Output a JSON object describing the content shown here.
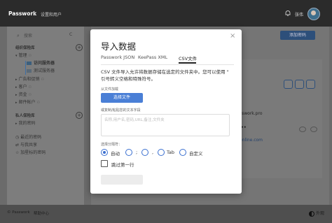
{
  "app": {
    "logo": "Passwork",
    "breadcrumb": "设置和用户",
    "user_name": "张伟"
  },
  "sidebar": {
    "search_placeholder": "搜索",
    "search_shortcut": "C",
    "org_section": "组织保险库",
    "items": [
      {
        "label": "管理"
      },
      {
        "label": "访问服务器"
      },
      {
        "label": "测试服务器"
      },
      {
        "label": "广告和促销"
      },
      {
        "label": "客户"
      },
      {
        "label": "资金"
      },
      {
        "label": "邮件帐户"
      }
    ],
    "private_section": "私人保险库",
    "private_items": [
      {
        "label": "我的密码"
      }
    ],
    "bottom_items": [
      {
        "label": "最近的密码"
      },
      {
        "label": "与我共享"
      },
      {
        "label": "加星标的密码"
      }
    ]
  },
  "content": {
    "add_password": "添加密码",
    "card_lines": [
      "sswork.pro",
      "••",
      "online.com"
    ]
  },
  "footer": {
    "copyright": "© Passwork",
    "help": "帮助中心",
    "theme": "外观"
  },
  "modal": {
    "title": "导入数据",
    "tabs": [
      "Passwork JSON",
      "KeePass XML",
      "CSV文件"
    ],
    "description": "CSV 文件导入允许将数据存储在选定的文件夹中。您可以使用 \" 引号转义空格和特殊符号。",
    "from_file_label": "从文件加载",
    "choose_file": "选择文件",
    "or_paste_label": "或复制/粘贴您的文本字段",
    "textarea_placeholder": "名称,用户名,密码,URL,备注,文件夹",
    "separator_label": "选择分隔符：",
    "separators": [
      "自动",
      ";",
      ",",
      "Tab",
      "自定义"
    ],
    "skip_first_row": "跳过第一行"
  },
  "colors": {
    "accent": "#4a7fd6",
    "topbar": "#2b2b2b"
  }
}
